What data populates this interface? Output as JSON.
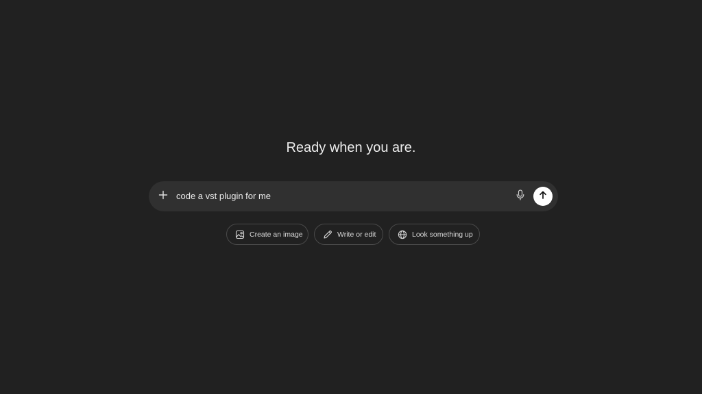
{
  "headline": "Ready when you are.",
  "composer": {
    "value": "code a vst plugin for me",
    "icons": {
      "add": "plus-icon",
      "voice": "microphone-icon",
      "send": "arrow-up-icon"
    }
  },
  "suggestions": [
    {
      "label": "Create an image",
      "icon": "image-icon"
    },
    {
      "label": "Write or edit",
      "icon": "pencil-icon"
    },
    {
      "label": "Look something up",
      "icon": "globe-icon"
    }
  ],
  "colors": {
    "background": "#212121",
    "composer": "#303030",
    "send_button": "#ffffff",
    "text": "#ececec"
  }
}
